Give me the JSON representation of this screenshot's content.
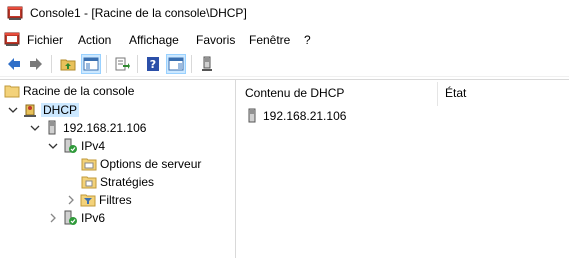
{
  "window": {
    "title": "Console1 - [Racine de la console\\DHCP]"
  },
  "menu": {
    "items": [
      "Fichier",
      "Action",
      "Affichage",
      "Favoris",
      "Fenêtre",
      "?"
    ]
  },
  "toolbar": {
    "buttons": [
      "back-icon",
      "forward-icon",
      "up-folder-icon",
      "show-hide-tree-icon",
      "export-list-icon",
      "help-icon",
      "action-pane-icon",
      "server-icon"
    ]
  },
  "tree": {
    "root": "Racine de la console",
    "dhcp": "DHCP",
    "server": "192.168.21.106",
    "ipv4": "IPv4",
    "server_options": "Options de serveur",
    "policies": "Stratégies",
    "filters": "Filtres",
    "ipv6": "IPv6"
  },
  "list": {
    "columns": [
      "Contenu de DHCP",
      "État"
    ],
    "rows": [
      {
        "name": "192.168.21.106",
        "status": ""
      }
    ]
  }
}
